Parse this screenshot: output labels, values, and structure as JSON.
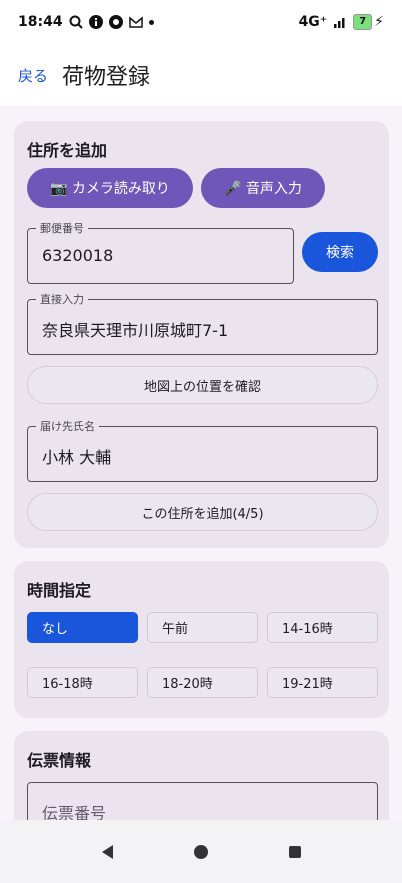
{
  "status_bar": {
    "time": "18:44",
    "network": "4G⁺",
    "battery": "7",
    "icons": [
      "search-icon",
      "info-icon",
      "vpn-icon",
      "mail-icon",
      "dot-icon",
      "signal-icon",
      "battery-icon",
      "charging-icon"
    ]
  },
  "app_bar": {
    "back_label": "戻る",
    "title": "荷物登録"
  },
  "address_card": {
    "title": "住所を追加",
    "camera_button": "📷 カメラ読み取り",
    "voice_button": "🎤 音声入力",
    "postal_label": "郵便番号",
    "postal_value": "6320018",
    "search_button": "検索",
    "direct_label": "直接入力",
    "direct_value": "奈良県天理市川原城町7-1",
    "map_button": "地図上の位置を確認",
    "recipient_label": "届け先氏名",
    "recipient_value": "小林 大輔",
    "add_button": "この住所を追加(4/5)"
  },
  "time_card": {
    "title": "時間指定",
    "options": [
      "なし",
      "午前",
      "14-16時",
      "16-18時",
      "18-20時",
      "19-21時"
    ],
    "selected": "なし"
  },
  "slip_card": {
    "title": "伝票情報",
    "slip_placeholder": "伝票番号"
  },
  "colors": {
    "accent": "#1a56db",
    "purple_button": "#6e57b8",
    "card_bg": "#ebe4ee"
  }
}
